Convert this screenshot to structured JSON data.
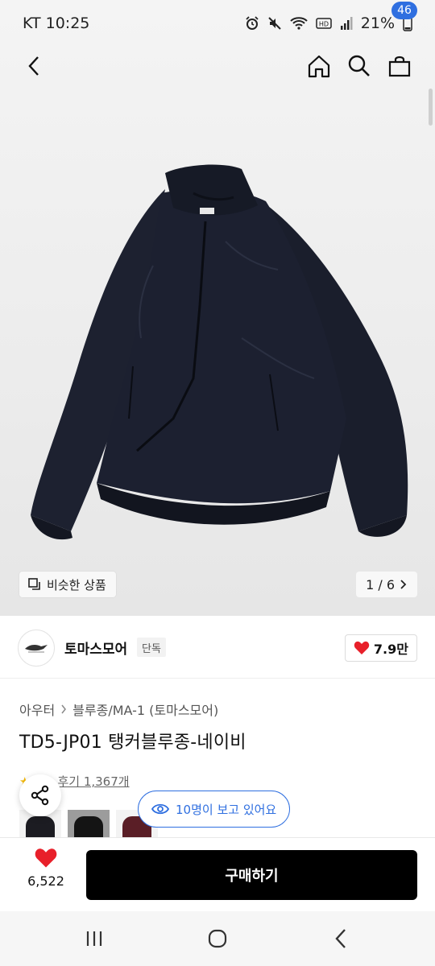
{
  "status_bar": {
    "carrier_time": "KT 10:25",
    "battery": "21%"
  },
  "header": {
    "cart_count": "46"
  },
  "image": {
    "similar_label": "비슷한 상품",
    "pager": "1 / 6"
  },
  "brand": {
    "name": "토마스모어",
    "tag": "단독",
    "likes": "7.9만"
  },
  "product": {
    "category": "아우터",
    "subcategory": "블루종/MA-1 (토마스모어)",
    "title": "TD5-JP01 탱커블루종-네이비",
    "reviews": "후기 1,367개"
  },
  "thumbnails": [
    {
      "color": "#1c1c22",
      "selected": false
    },
    {
      "color": "#141414",
      "selected": true
    },
    {
      "color": "#5a1e26",
      "selected": false
    }
  ],
  "viewers": "10명이 보고 있어요",
  "action": {
    "wish_count": "6,522",
    "buy_label": "구매하기"
  },
  "colors": {
    "accent": "#2f6fe0",
    "heart": "#e8202a",
    "buy_bg": "#000000"
  }
}
